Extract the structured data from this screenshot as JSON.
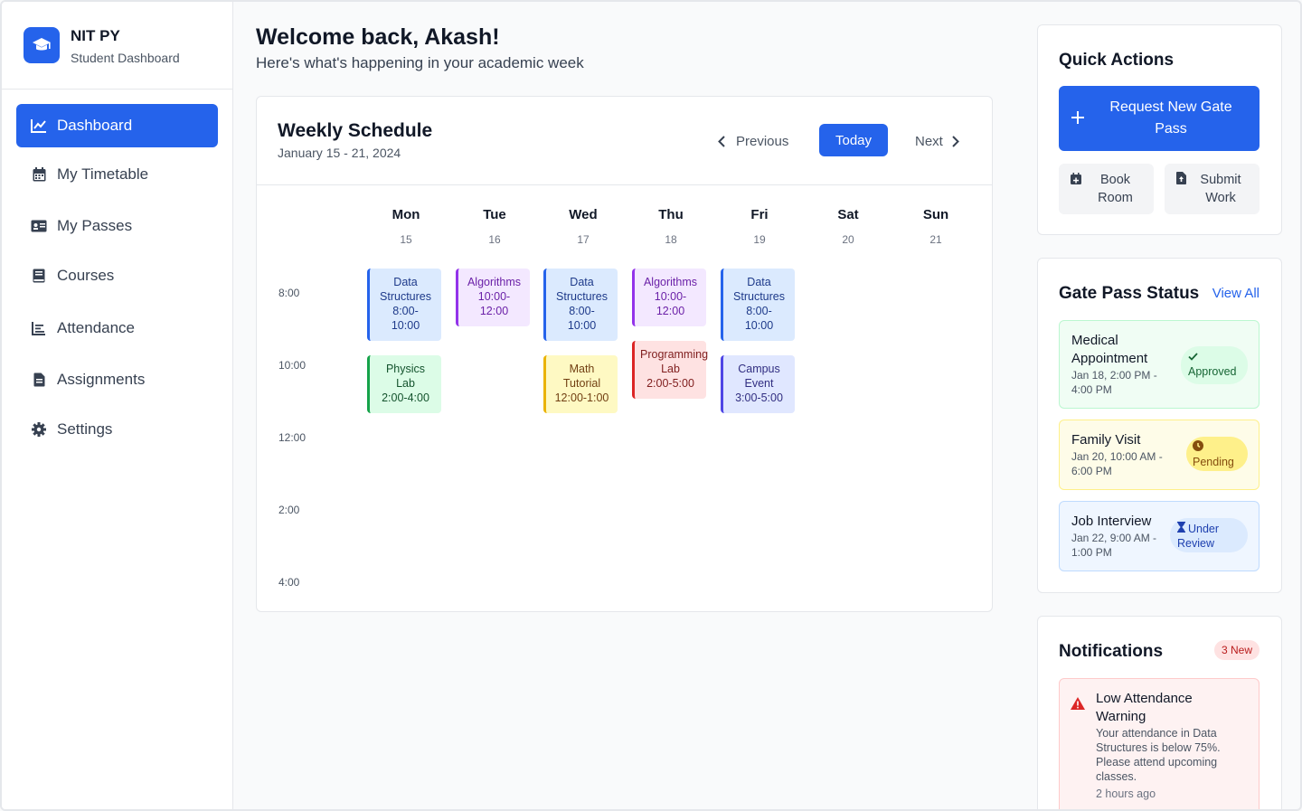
{
  "brand": {
    "name": "NIT PY",
    "subtitle": "Student Dashboard"
  },
  "nav": [
    {
      "label": "Dashboard",
      "icon": "chart-line-icon",
      "active": true
    },
    {
      "label": "My Timetable",
      "icon": "calendar-icon"
    },
    {
      "label": "My Passes",
      "icon": "id-card-icon"
    },
    {
      "label": "Courses",
      "icon": "book-icon"
    },
    {
      "label": "Attendance",
      "icon": "chart-bar-icon"
    },
    {
      "label": "Assignments",
      "icon": "file-icon"
    },
    {
      "label": "Settings",
      "icon": "gear-icon"
    }
  ],
  "header": {
    "title": "Welcome back, Akash!",
    "subtitle": "Here's what's happening in your academic week"
  },
  "schedule": {
    "title": "Weekly Schedule",
    "dates": "January 15 - 21, 2024",
    "prev_label": "Previous",
    "today_label": "Today",
    "next_label": "Next",
    "days": [
      {
        "name": "Mon",
        "num": "15"
      },
      {
        "name": "Tue",
        "num": "16"
      },
      {
        "name": "Wed",
        "num": "17"
      },
      {
        "name": "Thu",
        "num": "18"
      },
      {
        "name": "Fri",
        "num": "19"
      },
      {
        "name": "Sat",
        "num": "20"
      },
      {
        "name": "Sun",
        "num": "21"
      }
    ],
    "times": [
      "8:00",
      "10:00",
      "12:00",
      "2:00",
      "4:00"
    ],
    "events": [
      {
        "title": "Data Structures",
        "time": "8:00-10:00",
        "day": "Mon",
        "color": "blue"
      },
      {
        "title": "Physics Lab",
        "time": "2:00-4:00",
        "day": "Mon",
        "color": "green"
      },
      {
        "title": "Algorithms",
        "time": "10:00-12:00",
        "day": "Tue",
        "color": "purple"
      },
      {
        "title": "Data Structures",
        "time": "8:00-10:00",
        "day": "Wed",
        "color": "blue"
      },
      {
        "title": "Math Tutorial",
        "time": "12:00-1:00",
        "day": "Wed",
        "color": "yellow"
      },
      {
        "title": "Algorithms",
        "time": "10:00-12:00",
        "day": "Thu",
        "color": "purple"
      },
      {
        "title": "Programming Lab",
        "time": "2:00-5:00",
        "day": "Thu",
        "color": "red"
      },
      {
        "title": "Data Structures",
        "time": "8:00-10:00",
        "day": "Fri",
        "color": "blue"
      },
      {
        "title": "Campus Event",
        "time": "3:00-5:00",
        "day": "Fri",
        "color": "indigo"
      }
    ]
  },
  "quick_actions": {
    "title": "Quick Actions",
    "primary_label": "Request New Gate Pass",
    "book_room_label": "Book Room",
    "submit_work_label": "Submit Work"
  },
  "gate_pass": {
    "title": "Gate Pass Status",
    "view_all_label": "View All",
    "items": [
      {
        "title": "Medical Appointment",
        "time": "Jan 18, 2:00 PM - 4:00 PM",
        "status": "Approved",
        "status_icon": "check-icon"
      },
      {
        "title": "Family Visit",
        "time": "Jan 20, 10:00 AM - 6:00 PM",
        "status": "Pending",
        "status_icon": "clock-icon"
      },
      {
        "title": "Job Interview",
        "time": "Jan 22, 9:00 AM - 1:00 PM",
        "status": "Under Review",
        "status_icon": "hourglass-icon"
      }
    ]
  },
  "notifications": {
    "title": "Notifications",
    "badge": "3 New",
    "items": [
      {
        "title": "Low Attendance Warning",
        "body": "Your attendance in Data Structures is below 75%. Please attend upcoming classes.",
        "time": "2 hours ago",
        "icon": "warning-icon"
      }
    ]
  },
  "colors": {
    "primary": "#2563eb",
    "danger": "#dc2626",
    "success": "#16a34a",
    "warning": "#eab308"
  }
}
